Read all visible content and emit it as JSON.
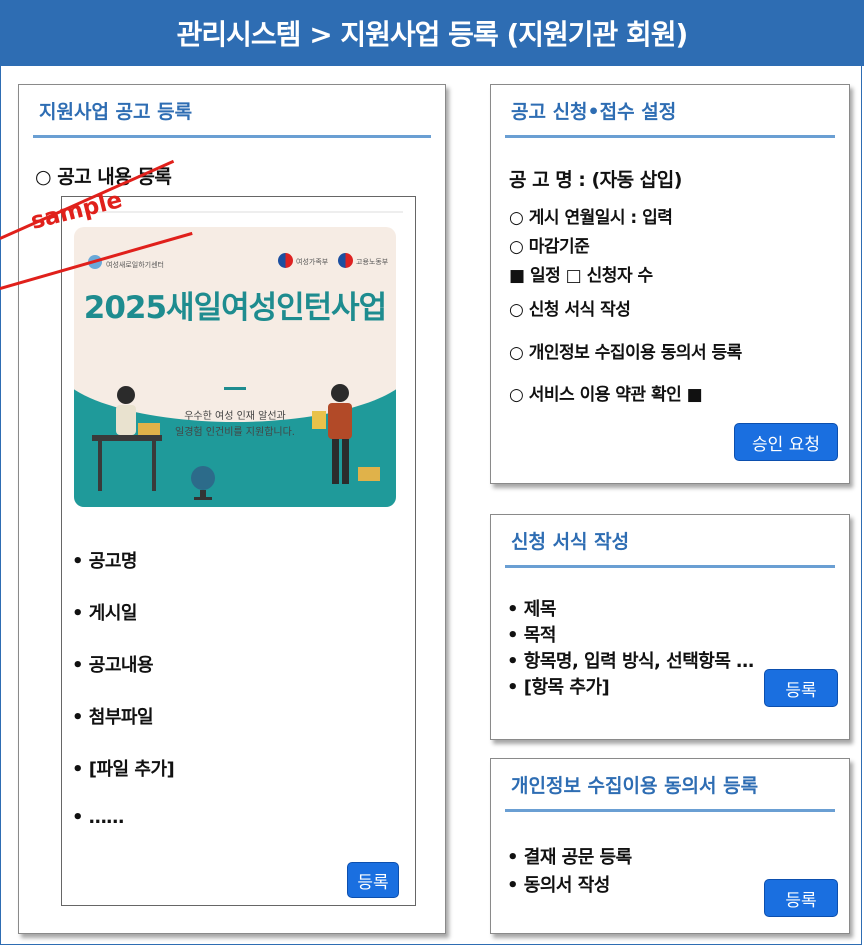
{
  "header": {
    "title": "관리시스템 > 지원사업 등록 (지원기관 회원)"
  },
  "left_panel": {
    "title": "지원사업 공고 등록",
    "section_label": "○ 공고 내용 등록",
    "watermark": "sample",
    "banner": {
      "headline": "2025새일여성인턴사업",
      "subtext_line1": "우수한 여성 인재 알선과",
      "subtext_line2": "일경험 인건비를 지원합니다.",
      "logo_left": "여성새로일하기센터",
      "logo_mid": "여성가족부",
      "logo_right": "고용노동부"
    },
    "items": [
      "• 공고명",
      "• 게시일",
      "• 공고내용",
      "• 첨부파일",
      "• [파일 추가]",
      "• ……"
    ],
    "register_button": "등록"
  },
  "apply_panel": {
    "title": "공고 신청•접수 설정",
    "lines": [
      "공 고 명 : (자동 삽입)",
      "○ 게시 연월일시 : 입력",
      "○ 마감기준",
      "■ 일정   □ 신청자 수",
      "○ 신청 서식 작성",
      "○ 개인정보 수집이용 동의서 등록",
      "○ 서비스 이용 약관 확인 ■"
    ],
    "approve_button": "승인 요청"
  },
  "form_panel": {
    "title": "신청 서식 작성",
    "items": [
      "• 제목",
      "• 목적",
      "• 항목명, 입력 방식, 선택항목 …",
      "• [항목 추가]"
    ],
    "register_button": "등록"
  },
  "consent_panel": {
    "title": "개인정보 수집이용 동의서 등록",
    "items": [
      "• 결재 공문 등록",
      "• 동의서 작성"
    ],
    "register_button": "등록"
  },
  "colors": {
    "header_blue": "#2e6db3",
    "button_blue": "#1a6fe0",
    "banner_teal": "#1f9a9a",
    "watermark_red": "#e0201b"
  }
}
